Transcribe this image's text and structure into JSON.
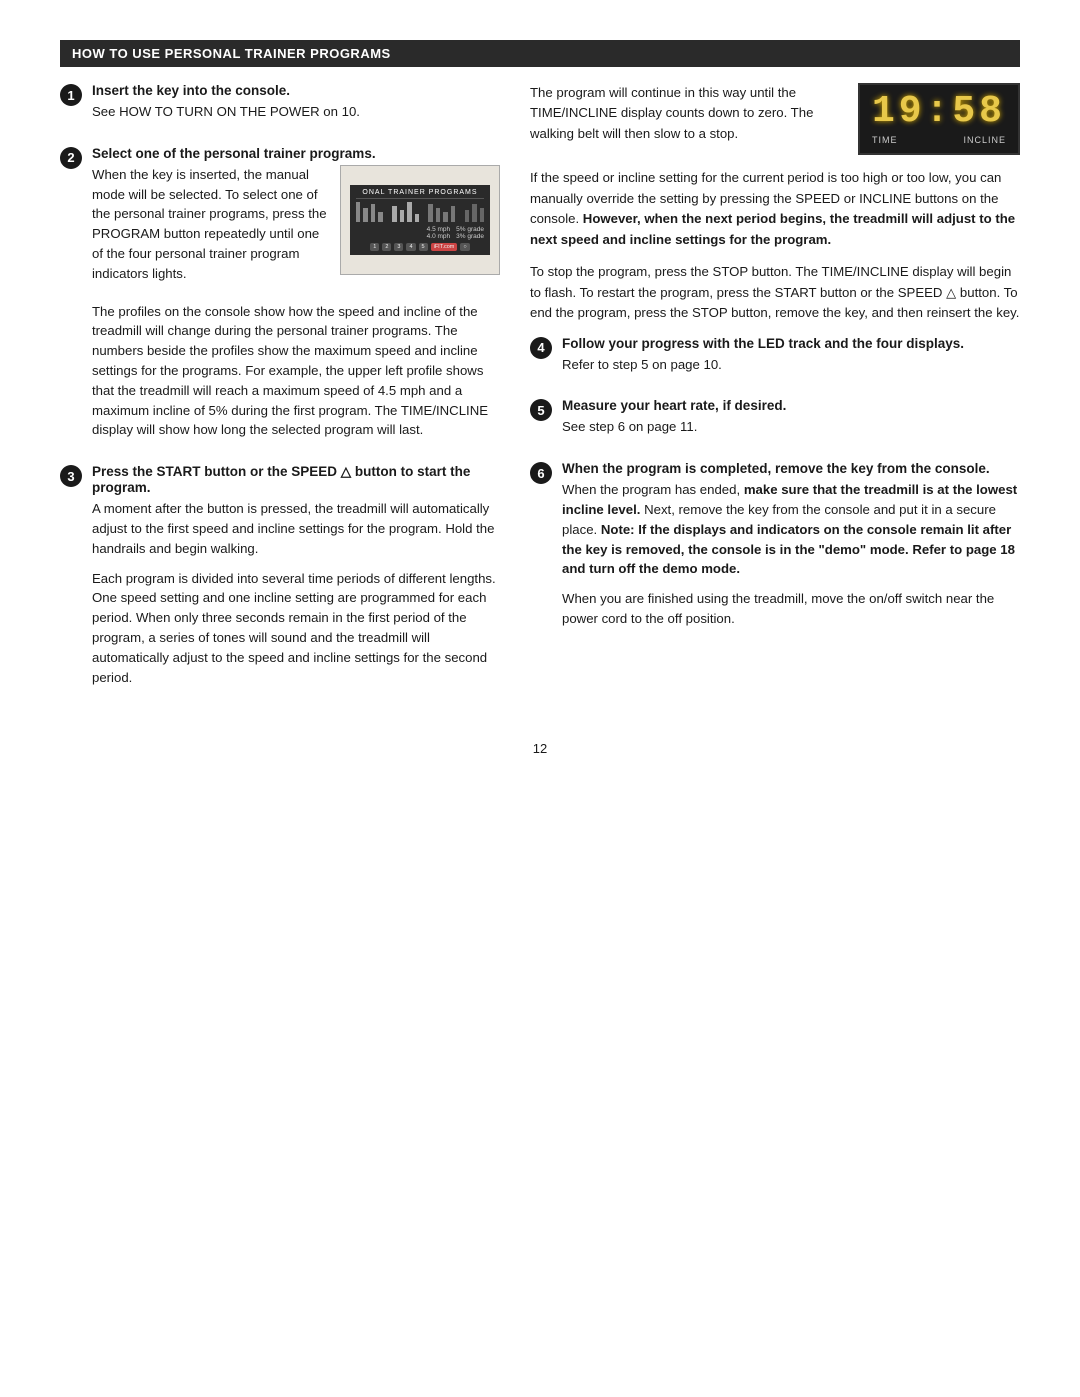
{
  "header": {
    "title": "HOW TO USE PERSONAL TRAINER PROGRAMS"
  },
  "led_display": {
    "digits": "19:58",
    "label_left": "TIME",
    "label_right": "INCLINE"
  },
  "steps": [
    {
      "num": "1",
      "title": "Insert the key into the console.",
      "body": "See HOW TO TURN ON THE POWER on 10."
    },
    {
      "num": "2",
      "title": "Select one of the personal trainer programs.",
      "body_before": "When the key is inserted, the manual mode will be selected. To select one of the personal trainer programs, press the PROGRAM button repeatedly until one of the four personal trainer program indicators lights.",
      "body_after": "The profiles on the console show how the speed and incline of the treadmill will change during the personal trainer programs. The numbers beside the profiles show the maximum speed and incline settings for the programs. For example, the upper left profile shows that the treadmill will reach a maximum speed of 4.5 mph and a maximum incline of 5% during the first program. The TIME/INCLINE display will show how long the selected program will last."
    },
    {
      "num": "3",
      "title": "Press the START button or the SPEED △ button to start the program.",
      "body1": "A moment after the button is pressed, the treadmill will automatically adjust to the first speed and incline settings for the program. Hold the handrails and begin walking.",
      "body2": "Each program is divided into several time periods of different lengths. One speed setting and one incline setting are programmed for each period. When only three seconds remain in the first period of the program, a series of tones will sound and the treadmill will automatically adjust to the speed and incline settings for the second period."
    },
    {
      "num": "4",
      "title": "Follow your progress with the LED track and the four displays.",
      "body": "Refer to step 5 on page 10."
    },
    {
      "num": "5",
      "title": "Measure your heart rate, if desired.",
      "body": "See step 6 on page 11."
    },
    {
      "num": "6",
      "title": "When the program is completed, remove the key from the console.",
      "body": "When the program has ended, make sure that the treadmill is at the lowest incline level. Next, remove the key from the console and put it in a secure place. Note: If the displays and indicators on the console remain lit after the key is removed, the console is in the \"demo\" mode. Refer to page 18 and turn off the demo mode.",
      "body2": "When you are finished using the treadmill, move the on/off switch near the power cord to the off position."
    }
  ],
  "right_col_intro": {
    "p1": "The program will continue in this way until the TIME/INCLINE display counts down to zero. The walking belt will then slow to a stop.",
    "p2": "If the speed or incline setting for the current period is too high or too low, you can manually override the setting by pressing the SPEED or INCLINE buttons on the console.",
    "p2_bold": "However, when the next period begins, the treadmill will adjust to the next speed and incline settings for the program.",
    "p3": "To stop the program, press the STOP button. The TIME/INCLINE display will begin to flash. To restart the program, press the START button or the SPEED △ button. To end the program, press the STOP button, remove the key, and then reinsert the key."
  },
  "page_number": "12",
  "console_labels": {
    "title": "ONAL TRAINER PROGRAMS",
    "speed1": "4.5 mph",
    "grade1": "5% grade",
    "speed2": "4.0 mph",
    "grade2": "3% grade",
    "brand": "iFIT.com"
  }
}
